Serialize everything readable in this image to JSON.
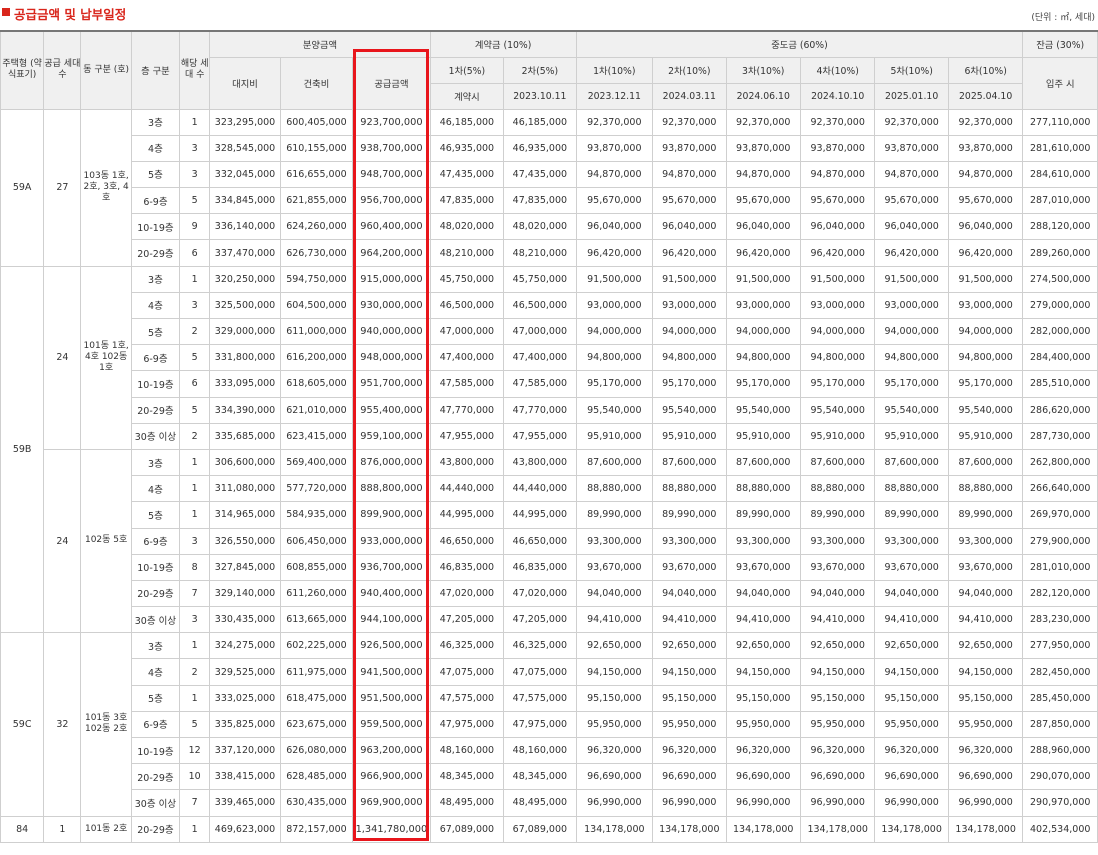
{
  "header": {
    "title": "공급금액 및 납부일정",
    "unit": "(단위 : ㎡, 세대)"
  },
  "columns": {
    "housing_type": "주택형 (약식표기)",
    "supply_units": "공급 세대수",
    "building": "동 구분 (호)",
    "floor": "층 구분",
    "units": "해당 세대 수",
    "price_group": "분양금액",
    "land": "대지비",
    "building_cost": "건축비",
    "total": "공급금액",
    "deposit_group": "계약금 (10%)",
    "mid_group": "중도금 (60%)",
    "balance_group": "잔금 (30%)",
    "d1": "1차(5%)",
    "d2": "2차(5%)",
    "m1": "1차(10%)",
    "m2": "2차(10%)",
    "m3": "3차(10%)",
    "m4": "4차(10%)",
    "m5": "5차(10%)",
    "m6": "6차(10%)",
    "d1_date": "계약시",
    "d2_date": "2023.10.11",
    "m1_date": "2023.12.11",
    "m2_date": "2024.03.11",
    "m3_date": "2024.06.10",
    "m4_date": "2024.10.10",
    "m5_date": "2025.01.10",
    "m6_date": "2025.04.10",
    "balance_date": "입주 시"
  },
  "groups": [
    {
      "type": "59A",
      "rowspan": 6
    },
    {
      "type": "59B",
      "rowspan": 14
    },
    {
      "type": "59C",
      "rowspan": 7
    },
    {
      "type": "84",
      "rowspan": 1
    }
  ],
  "subgroups": [
    {
      "supply": "27",
      "building": "103동 1호, 2호, 3호, 4호",
      "rowspan": 6
    },
    {
      "supply": "24",
      "building": "101동 1호, 4호 102동 1호",
      "rowspan": 7
    },
    {
      "supply": "24",
      "building": "102동 5호",
      "rowspan": 7
    },
    {
      "supply": "32",
      "building": "101동 3호 102동 2호",
      "rowspan": 7
    },
    {
      "supply": "1",
      "building": "101동 2호",
      "rowspan": 1
    }
  ],
  "rows": [
    [
      "3층",
      "1",
      "323,295,000",
      "600,405,000",
      "923,700,000",
      "46,185,000",
      "46,185,000",
      "92,370,000",
      "92,370,000",
      "92,370,000",
      "92,370,000",
      "92,370,000",
      "92,370,000",
      "277,110,000"
    ],
    [
      "4층",
      "3",
      "328,545,000",
      "610,155,000",
      "938,700,000",
      "46,935,000",
      "46,935,000",
      "93,870,000",
      "93,870,000",
      "93,870,000",
      "93,870,000",
      "93,870,000",
      "93,870,000",
      "281,610,000"
    ],
    [
      "5층",
      "3",
      "332,045,000",
      "616,655,000",
      "948,700,000",
      "47,435,000",
      "47,435,000",
      "94,870,000",
      "94,870,000",
      "94,870,000",
      "94,870,000",
      "94,870,000",
      "94,870,000",
      "284,610,000"
    ],
    [
      "6-9층",
      "5",
      "334,845,000",
      "621,855,000",
      "956,700,000",
      "47,835,000",
      "47,835,000",
      "95,670,000",
      "95,670,000",
      "95,670,000",
      "95,670,000",
      "95,670,000",
      "95,670,000",
      "287,010,000"
    ],
    [
      "10-19층",
      "9",
      "336,140,000",
      "624,260,000",
      "960,400,000",
      "48,020,000",
      "48,020,000",
      "96,040,000",
      "96,040,000",
      "96,040,000",
      "96,040,000",
      "96,040,000",
      "96,040,000",
      "288,120,000"
    ],
    [
      "20-29층",
      "6",
      "337,470,000",
      "626,730,000",
      "964,200,000",
      "48,210,000",
      "48,210,000",
      "96,420,000",
      "96,420,000",
      "96,420,000",
      "96,420,000",
      "96,420,000",
      "96,420,000",
      "289,260,000"
    ],
    [
      "3층",
      "1",
      "320,250,000",
      "594,750,000",
      "915,000,000",
      "45,750,000",
      "45,750,000",
      "91,500,000",
      "91,500,000",
      "91,500,000",
      "91,500,000",
      "91,500,000",
      "91,500,000",
      "274,500,000"
    ],
    [
      "4층",
      "3",
      "325,500,000",
      "604,500,000",
      "930,000,000",
      "46,500,000",
      "46,500,000",
      "93,000,000",
      "93,000,000",
      "93,000,000",
      "93,000,000",
      "93,000,000",
      "93,000,000",
      "279,000,000"
    ],
    [
      "5층",
      "2",
      "329,000,000",
      "611,000,000",
      "940,000,000",
      "47,000,000",
      "47,000,000",
      "94,000,000",
      "94,000,000",
      "94,000,000",
      "94,000,000",
      "94,000,000",
      "94,000,000",
      "282,000,000"
    ],
    [
      "6-9층",
      "5",
      "331,800,000",
      "616,200,000",
      "948,000,000",
      "47,400,000",
      "47,400,000",
      "94,800,000",
      "94,800,000",
      "94,800,000",
      "94,800,000",
      "94,800,000",
      "94,800,000",
      "284,400,000"
    ],
    [
      "10-19층",
      "6",
      "333,095,000",
      "618,605,000",
      "951,700,000",
      "47,585,000",
      "47,585,000",
      "95,170,000",
      "95,170,000",
      "95,170,000",
      "95,170,000",
      "95,170,000",
      "95,170,000",
      "285,510,000"
    ],
    [
      "20-29층",
      "5",
      "334,390,000",
      "621,010,000",
      "955,400,000",
      "47,770,000",
      "47,770,000",
      "95,540,000",
      "95,540,000",
      "95,540,000",
      "95,540,000",
      "95,540,000",
      "95,540,000",
      "286,620,000"
    ],
    [
      "30층 이상",
      "2",
      "335,685,000",
      "623,415,000",
      "959,100,000",
      "47,955,000",
      "47,955,000",
      "95,910,000",
      "95,910,000",
      "95,910,000",
      "95,910,000",
      "95,910,000",
      "95,910,000",
      "287,730,000"
    ],
    [
      "3층",
      "1",
      "306,600,000",
      "569,400,000",
      "876,000,000",
      "43,800,000",
      "43,800,000",
      "87,600,000",
      "87,600,000",
      "87,600,000",
      "87,600,000",
      "87,600,000",
      "87,600,000",
      "262,800,000"
    ],
    [
      "4층",
      "1",
      "311,080,000",
      "577,720,000",
      "888,800,000",
      "44,440,000",
      "44,440,000",
      "88,880,000",
      "88,880,000",
      "88,880,000",
      "88,880,000",
      "88,880,000",
      "88,880,000",
      "266,640,000"
    ],
    [
      "5층",
      "1",
      "314,965,000",
      "584,935,000",
      "899,900,000",
      "44,995,000",
      "44,995,000",
      "89,990,000",
      "89,990,000",
      "89,990,000",
      "89,990,000",
      "89,990,000",
      "89,990,000",
      "269,970,000"
    ],
    [
      "6-9층",
      "3",
      "326,550,000",
      "606,450,000",
      "933,000,000",
      "46,650,000",
      "46,650,000",
      "93,300,000",
      "93,300,000",
      "93,300,000",
      "93,300,000",
      "93,300,000",
      "93,300,000",
      "279,900,000"
    ],
    [
      "10-19층",
      "8",
      "327,845,000",
      "608,855,000",
      "936,700,000",
      "46,835,000",
      "46,835,000",
      "93,670,000",
      "93,670,000",
      "93,670,000",
      "93,670,000",
      "93,670,000",
      "93,670,000",
      "281,010,000"
    ],
    [
      "20-29층",
      "7",
      "329,140,000",
      "611,260,000",
      "940,400,000",
      "47,020,000",
      "47,020,000",
      "94,040,000",
      "94,040,000",
      "94,040,000",
      "94,040,000",
      "94,040,000",
      "94,040,000",
      "282,120,000"
    ],
    [
      "30층 이상",
      "3",
      "330,435,000",
      "613,665,000",
      "944,100,000",
      "47,205,000",
      "47,205,000",
      "94,410,000",
      "94,410,000",
      "94,410,000",
      "94,410,000",
      "94,410,000",
      "94,410,000",
      "283,230,000"
    ],
    [
      "3층",
      "1",
      "324,275,000",
      "602,225,000",
      "926,500,000",
      "46,325,000",
      "46,325,000",
      "92,650,000",
      "92,650,000",
      "92,650,000",
      "92,650,000",
      "92,650,000",
      "92,650,000",
      "277,950,000"
    ],
    [
      "4층",
      "2",
      "329,525,000",
      "611,975,000",
      "941,500,000",
      "47,075,000",
      "47,075,000",
      "94,150,000",
      "94,150,000",
      "94,150,000",
      "94,150,000",
      "94,150,000",
      "94,150,000",
      "282,450,000"
    ],
    [
      "5층",
      "1",
      "333,025,000",
      "618,475,000",
      "951,500,000",
      "47,575,000",
      "47,575,000",
      "95,150,000",
      "95,150,000",
      "95,150,000",
      "95,150,000",
      "95,150,000",
      "95,150,000",
      "285,450,000"
    ],
    [
      "6-9층",
      "5",
      "335,825,000",
      "623,675,000",
      "959,500,000",
      "47,975,000",
      "47,975,000",
      "95,950,000",
      "95,950,000",
      "95,950,000",
      "95,950,000",
      "95,950,000",
      "95,950,000",
      "287,850,000"
    ],
    [
      "10-19층",
      "12",
      "337,120,000",
      "626,080,000",
      "963,200,000",
      "48,160,000",
      "48,160,000",
      "96,320,000",
      "96,320,000",
      "96,320,000",
      "96,320,000",
      "96,320,000",
      "96,320,000",
      "288,960,000"
    ],
    [
      "20-29층",
      "10",
      "338,415,000",
      "628,485,000",
      "966,900,000",
      "48,345,000",
      "48,345,000",
      "96,690,000",
      "96,690,000",
      "96,690,000",
      "96,690,000",
      "96,690,000",
      "96,690,000",
      "290,070,000"
    ],
    [
      "30층 이상",
      "7",
      "339,465,000",
      "630,435,000",
      "969,900,000",
      "48,495,000",
      "48,495,000",
      "96,990,000",
      "96,990,000",
      "96,990,000",
      "96,990,000",
      "96,990,000",
      "96,990,000",
      "290,970,000"
    ],
    [
      "20-29층",
      "1",
      "469,623,000",
      "872,157,000",
      "1,341,780,000",
      "67,089,000",
      "67,089,000",
      "134,178,000",
      "134,178,000",
      "134,178,000",
      "134,178,000",
      "134,178,000",
      "134,178,000",
      "402,534,000"
    ]
  ]
}
